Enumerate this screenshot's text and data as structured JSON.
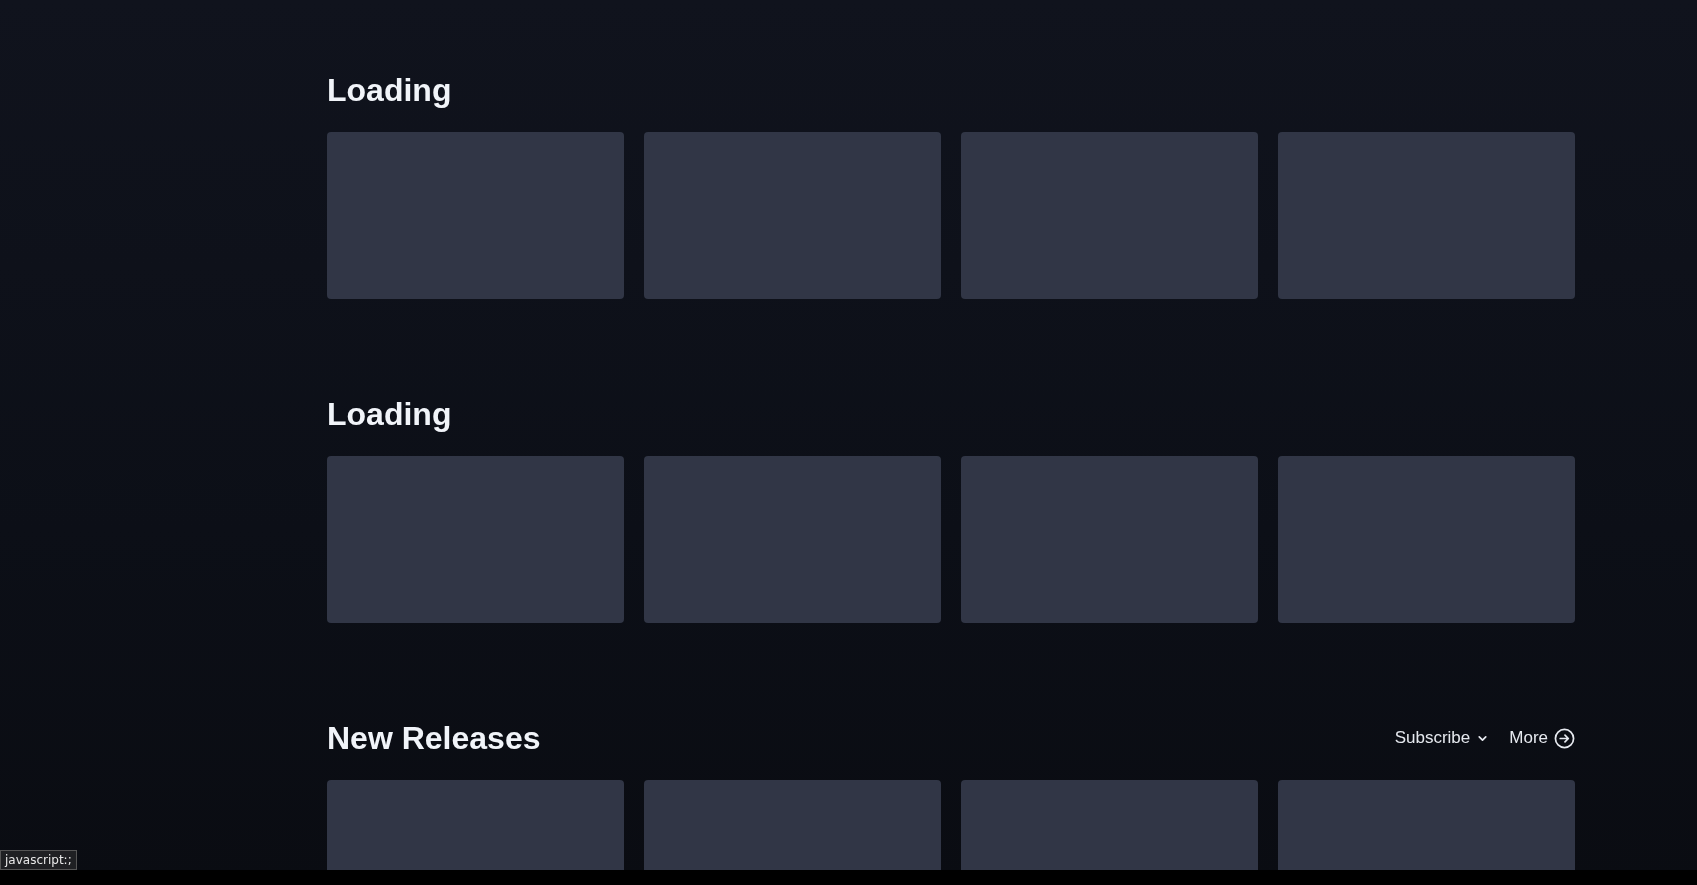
{
  "sections": [
    {
      "title": "Loading",
      "cards": [
        {
          "kind": "skeleton"
        },
        {
          "kind": "skeleton"
        },
        {
          "kind": "skeleton"
        },
        {
          "kind": "skeleton"
        }
      ]
    },
    {
      "title": "Loading",
      "cards": [
        {
          "kind": "skeleton"
        },
        {
          "kind": "skeleton"
        },
        {
          "kind": "skeleton"
        },
        {
          "kind": "skeleton"
        }
      ]
    },
    {
      "title": "New Releases",
      "actions": [
        {
          "label": "Subscribe",
          "kind": "dropdown"
        },
        {
          "label": "More",
          "kind": "arrow"
        }
      ],
      "cards": [
        {
          "kind": "skeleton"
        },
        {
          "kind": "skeleton"
        },
        {
          "kind": "skeleton"
        },
        {
          "kind": "skeleton"
        }
      ]
    }
  ],
  "status_bar": {
    "text": "javascript:;"
  }
}
